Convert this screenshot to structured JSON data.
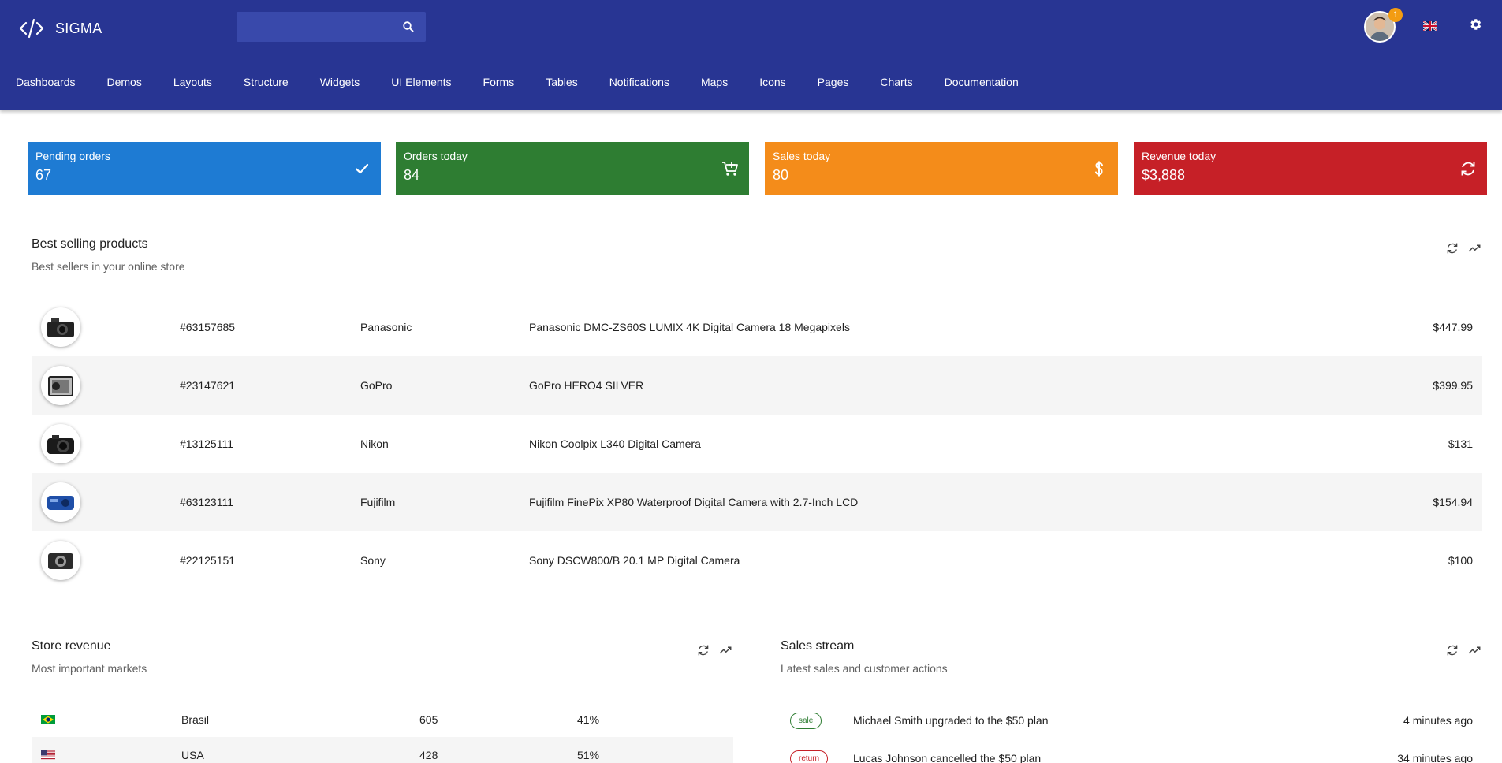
{
  "app": {
    "name": "SIGMA",
    "notifications": "1"
  },
  "search": {
    "placeholder": ""
  },
  "nav": [
    "Dashboards",
    "Demos",
    "Layouts",
    "Structure",
    "Widgets",
    "UI Elements",
    "Forms",
    "Tables",
    "Notifications",
    "Maps",
    "Icons",
    "Pages",
    "Charts",
    "Documentation"
  ],
  "tiles": [
    {
      "label": "Pending orders",
      "value": "67",
      "color": "#1e7bd3",
      "icon": "check-icon"
    },
    {
      "label": "Orders today",
      "value": "84",
      "color": "#2e7d32",
      "icon": "cart-icon"
    },
    {
      "label": "Sales today",
      "value": "80",
      "color": "#f48c1a",
      "icon": "dollar-icon"
    },
    {
      "label": "Revenue today",
      "value": "$3,888",
      "color": "#c62027",
      "icon": "refresh-icon"
    }
  ],
  "best_selling": {
    "title": "Best selling products",
    "subtitle": "Best sellers in your online store",
    "rows": [
      {
        "id": "#63157685",
        "brand": "Panasonic",
        "name": "Panasonic DMC-ZS60S LUMIX 4K Digital Camera 18 Megapixels",
        "price": "$447.99",
        "image": "camera-icon"
      },
      {
        "id": "#23147621",
        "brand": "GoPro",
        "name": "GoPro HERO4 SILVER",
        "price": "$399.95",
        "image": "action-camera-icon"
      },
      {
        "id": "#13125111",
        "brand": "Nikon",
        "name": "Nikon Coolpix L340 Digital Camera",
        "price": "$131",
        "image": "camera-icon"
      },
      {
        "id": "#63123111",
        "brand": "Fujifilm",
        "name": "Fujifilm FinePix XP80 Waterproof Digital Camera with 2.7-Inch LCD",
        "price": "$154.94",
        "image": "camera-icon"
      },
      {
        "id": "#22125151",
        "brand": "Sony",
        "name": "Sony DSCW800/B 20.1 MP Digital Camera",
        "price": "$100",
        "image": "camera-icon"
      }
    ]
  },
  "store_revenue": {
    "title": "Store revenue",
    "subtitle": "Most important markets",
    "rows": [
      {
        "country": "Brasil",
        "count": "605",
        "percent": "41%",
        "flag": "flag-br-icon"
      },
      {
        "country": "USA",
        "count": "428",
        "percent": "51%",
        "flag": "flag-us-icon"
      }
    ]
  },
  "sales_stream": {
    "title": "Sales stream",
    "subtitle": "Latest sales and customer actions",
    "rows": [
      {
        "tag": "sale",
        "text": "Michael Smith upgraded to the $50 plan",
        "time": "4 minutes ago"
      },
      {
        "tag": "return",
        "text": "Lucas Johnson cancelled the $50 plan",
        "time": "34 minutes ago"
      }
    ]
  }
}
